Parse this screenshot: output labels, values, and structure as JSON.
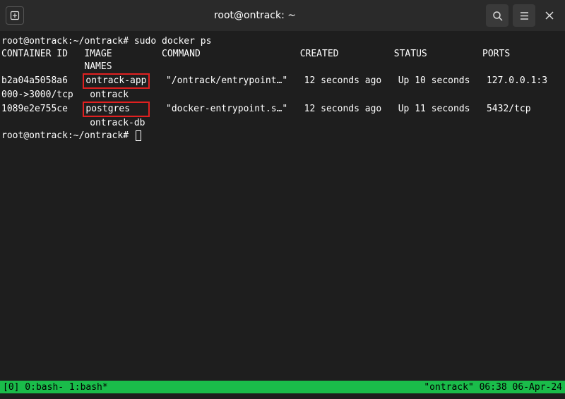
{
  "header": {
    "title": "root@ontrack: ~",
    "new_tab_icon": "⊞",
    "search_icon": "⌕",
    "menu_icon": "≡",
    "close_icon": "✕"
  },
  "prompt": {
    "p1_user_host": "root@ontrack",
    "p1_sep": ":",
    "p1_path": "~/ontrack",
    "p1_end": "# ",
    "p1_cmd": "sudo docker ps",
    "p2_user_host": "root@ontrack",
    "p2_sep": ":",
    "p2_path": "~/ontrack",
    "p2_end": "# "
  },
  "table": {
    "h_container": "CONTAINER ID",
    "h_image": "IMAGE",
    "h_command": "COMMAND",
    "h_created": "CREATED",
    "h_status": "STATUS",
    "h_ports": "PORTS",
    "h_names": "NAMES",
    "rows": [
      {
        "container": "b2a04a5058a6",
        "image": "ontrack-app",
        "command": "\"/ontrack/entrypoint…\"",
        "created": "12 seconds ago",
        "status": "Up 10 seconds",
        "ports": "127.0.0.1:3",
        "ports_wrap": "000->3000/tcp",
        "name": "ontrack"
      },
      {
        "container": "1089e2e755ce",
        "image": "postgres",
        "command": "\"docker-entrypoint.s…\"",
        "created": "12 seconds ago",
        "status": "Up 11 seconds",
        "ports": "5432/tcp",
        "name": "ontrack-db"
      }
    ]
  },
  "status": {
    "left": "[0] 0:bash- 1:bash*",
    "right": "\"ontrack\" 06:38 06-Apr-24"
  }
}
